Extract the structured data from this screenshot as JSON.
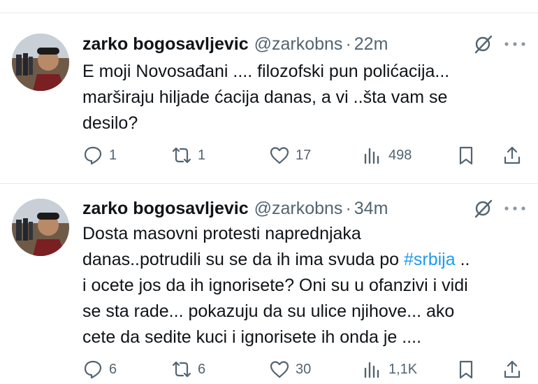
{
  "tweets": [
    {
      "author_name": "zarko bogosavljevic",
      "handle": "@zarkobns",
      "separator": "·",
      "time": "22m",
      "text_lines": [
        "E moji Novosađani .... filozofski pun polićacija...",
        "marširaju hiljade ćacija danas, a vi ..šta vam se",
        "desilo?"
      ],
      "stats": {
        "replies": "1",
        "reposts": "1",
        "likes": "17",
        "views": "498"
      }
    },
    {
      "author_name": "zarko bogosavljevic",
      "handle": "@zarkobns",
      "separator": "·",
      "time": "34m",
      "text_lines": [
        "Dosta masovni protesti naprednjaka",
        "i ocete jos da ih ignorisete? Oni su u ofanzivi i vidi",
        "se sta rade... pokazuju da su ulice njihove... ako",
        "cete da sedite kuci i ignorisete ih onda je ...."
      ],
      "line2_before_tag": "danas..potrudili su se da ih ima svuda po ",
      "hashtag": "#srbija",
      "line2_after_tag": " ..",
      "stats": {
        "replies": "6",
        "reposts": "6",
        "likes": "30",
        "views": "1,1K"
      }
    }
  ],
  "icons": [
    "reply-icon",
    "repost-icon",
    "like-icon",
    "views-icon",
    "bookmark-icon",
    "share-icon",
    "grok-icon",
    "more-icon"
  ],
  "colors": {
    "text": "#0f1419",
    "secondary": "#536471",
    "link": "#1d9bf0",
    "divider": "#e6e9ec"
  }
}
